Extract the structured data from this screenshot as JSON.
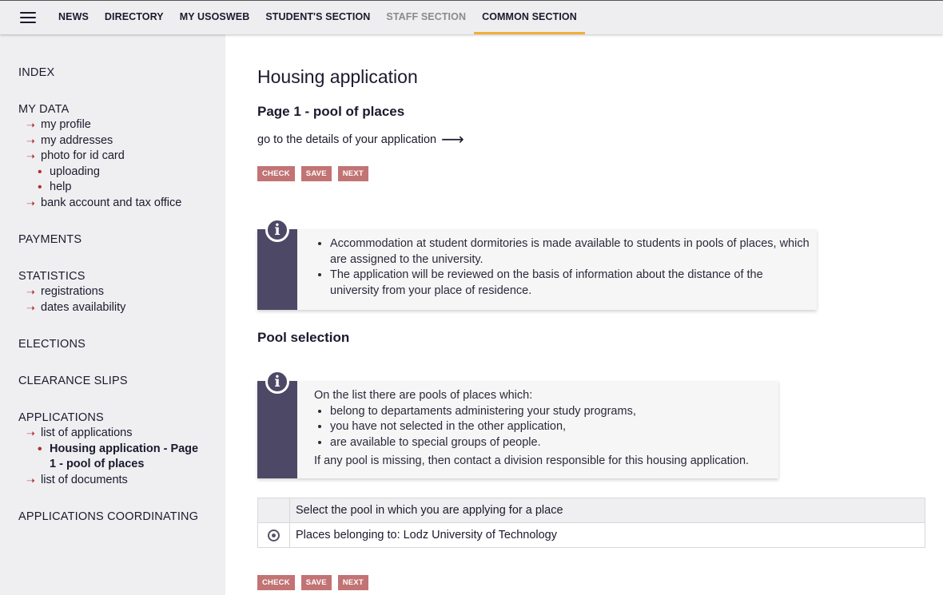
{
  "nav": {
    "items": [
      {
        "label": "NEWS"
      },
      {
        "label": "DIRECTORY"
      },
      {
        "label": "MY USOSWEB"
      },
      {
        "label": "STUDENT'S SECTION"
      },
      {
        "label": "STAFF SECTION"
      },
      {
        "label": "COMMON SECTION"
      }
    ]
  },
  "sidebar": {
    "index": "INDEX",
    "my_data": {
      "label": "MY DATA",
      "my_profile": "my profile",
      "my_addresses": "my addresses",
      "photo": "photo for id card",
      "uploading": "uploading",
      "help": "help",
      "bank": "bank account and tax office"
    },
    "payments": "PAYMENTS",
    "statistics": {
      "label": "STATISTICS",
      "registrations": "registrations",
      "dates": "dates availability"
    },
    "elections": "ELECTIONS",
    "clearance": "CLEARANCE SLIPS",
    "applications": {
      "label": "APPLICATIONS",
      "list": "list of applications",
      "current_line1": "Housing application - Page",
      "current_line2": "1 - pool of places",
      "documents": "list of documents"
    },
    "coordinating": "APPLICATIONS COORDINATING"
  },
  "main": {
    "title": "Housing application",
    "subtitle": "Page 1 - pool of places",
    "details_link": "go to the details of your application",
    "buttons": {
      "check": "CHECK",
      "save": "SAVE",
      "next": "NEXT"
    },
    "info1": [
      "Accommodation at student dormitories is made available to students in pools of places, which are assigned to the university.",
      "The application will be reviewed on the basis of information about the distance of the university from your place of residence."
    ],
    "pool_title": "Pool selection",
    "info2": {
      "intro": "On the list there are pools of places which:",
      "items": [
        "belong to departaments administering your study programs,",
        "you have not selected in the other application,",
        "are available to special groups of people."
      ],
      "outro": "If any pool is missing, then contact a division responsible for this housing application."
    },
    "table": {
      "header": "Select the pool in which you are applying for a place",
      "rows": [
        {
          "label": "Places belonging to: Lodz University of Technology",
          "selected": true
        }
      ]
    }
  }
}
